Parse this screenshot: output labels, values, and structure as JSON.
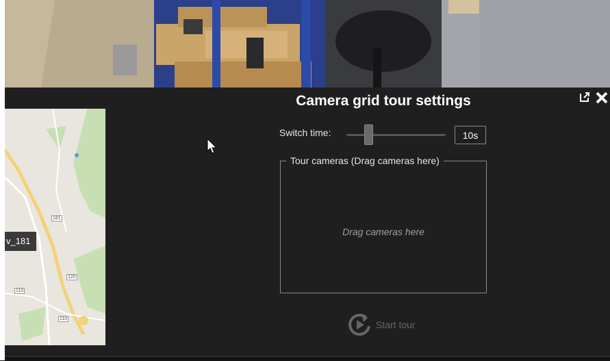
{
  "dialog": {
    "title": "Camera grid tour settings",
    "popout_icon": "popout-icon",
    "close_icon": "close-icon"
  },
  "switch_time": {
    "label": "Switch time:",
    "value": "10s",
    "slider_fraction": 0.2
  },
  "tour_cameras": {
    "legend": "Tour cameras (Drag cameras here)",
    "placeholder": "Drag cameras here"
  },
  "start_tour": {
    "label": "Start tour",
    "icon": "play-refresh-icon",
    "enabled": false
  },
  "map": {
    "camera_label": "v_181",
    "road_labels": [
      "181",
      "120",
      "110",
      "110"
    ]
  },
  "colors": {
    "background": "#1f1f1f",
    "text": "#ffffff",
    "disabled": "#666666",
    "border": "#8a8a8a"
  }
}
